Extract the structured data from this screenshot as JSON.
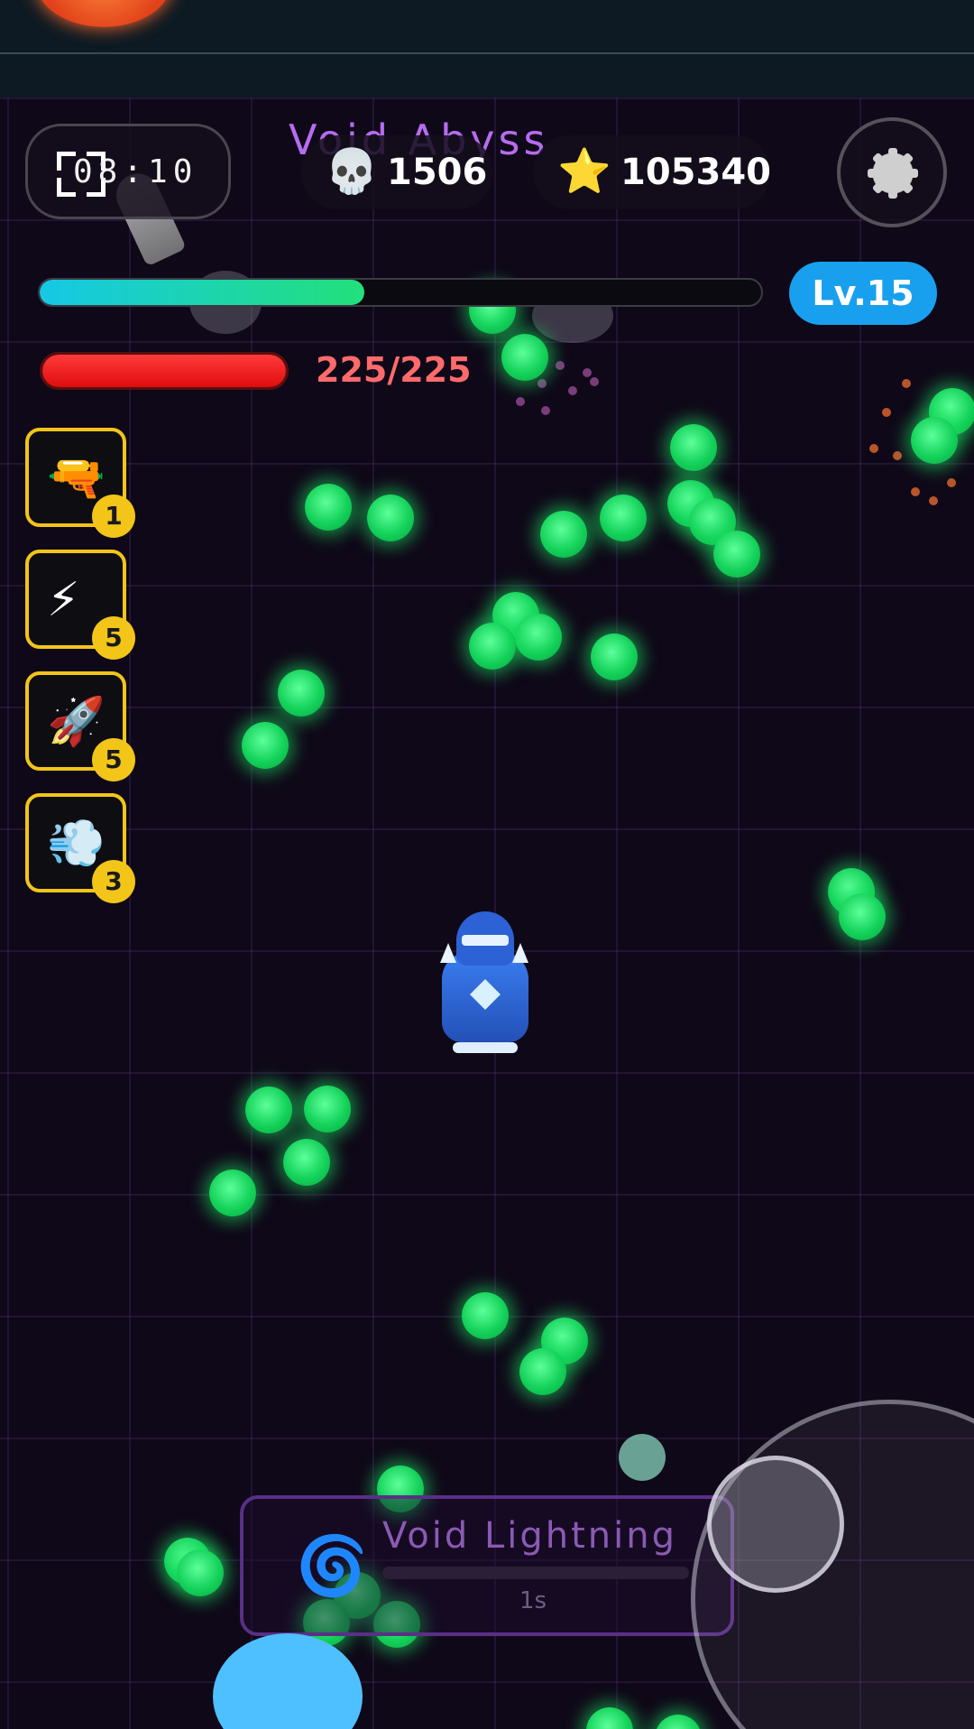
{
  "hud": {
    "timer": "08:10",
    "zone_title": "Void Abyss",
    "kills": "1506",
    "stars": "105340",
    "level": "Lv.15",
    "xp_progress": 0.45,
    "hp_text": "225/225",
    "hp_progress": 1.0
  },
  "icons": {
    "kills": "💀",
    "stars": "⭐",
    "settings": "gear-icon"
  },
  "skills": [
    {
      "name": "water-gun",
      "glyph": "🔫",
      "level": "1"
    },
    {
      "name": "lightning",
      "glyph": "⚡",
      "level": "5"
    },
    {
      "name": "rocket",
      "glyph": "🚀",
      "level": "5"
    },
    {
      "name": "dash-cloud",
      "glyph": "💨",
      "level": "3"
    }
  ],
  "active_skill": {
    "title": "Void Lightning",
    "cooldown": "1s",
    "glyph": "🌀"
  },
  "colors": {
    "xp_start": "#16c8e6",
    "xp_end": "#22e07a",
    "hp": "#ff3a3a",
    "level_badge": "#18a0ee",
    "slot_border": "#f2c518",
    "orb": "#14d25a",
    "zone_title": "#b66cf0"
  }
}
